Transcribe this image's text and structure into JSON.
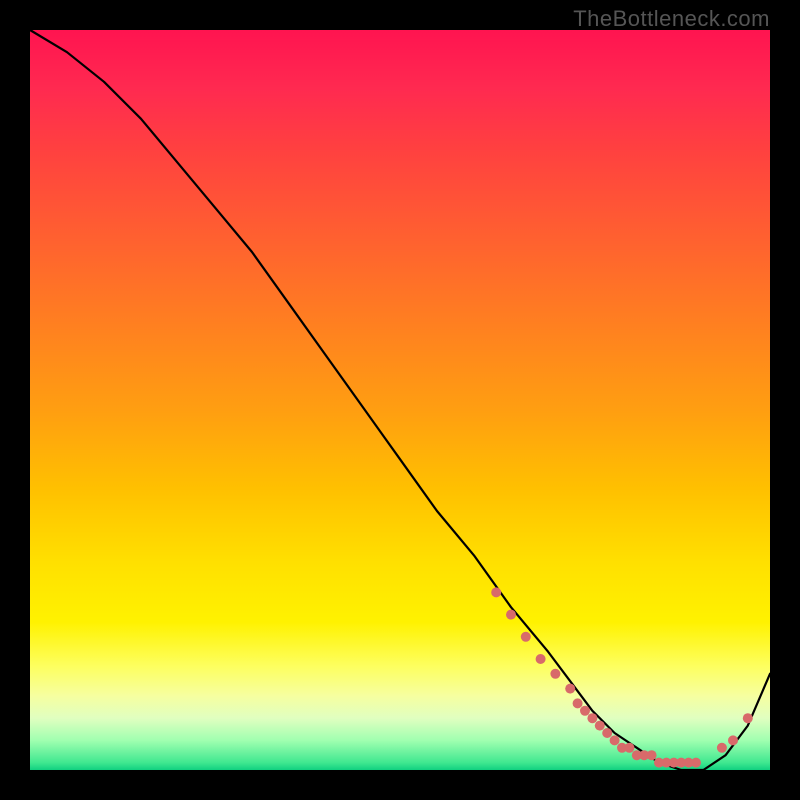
{
  "watermark": "TheBottleneck.com",
  "chart_data": {
    "type": "line",
    "title": "",
    "xlabel": "",
    "ylabel": "",
    "xlim": [
      0,
      100
    ],
    "ylim": [
      0,
      100
    ],
    "grid": false,
    "legend": false,
    "series": [
      {
        "name": "curve",
        "x": [
          0,
          5,
          10,
          15,
          20,
          25,
          30,
          35,
          40,
          45,
          50,
          55,
          60,
          65,
          70,
          73,
          76,
          79,
          82,
          85,
          88,
          91,
          94,
          97,
          100
        ],
        "values": [
          100,
          97,
          93,
          88,
          82,
          76,
          70,
          63,
          56,
          49,
          42,
          35,
          29,
          22,
          16,
          12,
          8,
          5,
          3,
          1,
          0,
          0,
          2,
          6,
          13
        ]
      }
    ],
    "markers": {
      "name": "dots",
      "color": "#d86a6a",
      "x": [
        63,
        65,
        67,
        69,
        71,
        73,
        74,
        75,
        76,
        77,
        78,
        79,
        80,
        81,
        82,
        83,
        84,
        85,
        86,
        87,
        88,
        89,
        90,
        93.5,
        95,
        97
      ],
      "values": [
        24,
        21,
        18,
        15,
        13,
        11,
        9,
        8,
        7,
        6,
        5,
        4,
        3,
        3,
        2,
        2,
        2,
        1,
        1,
        1,
        1,
        1,
        1,
        3,
        4,
        7
      ]
    }
  }
}
